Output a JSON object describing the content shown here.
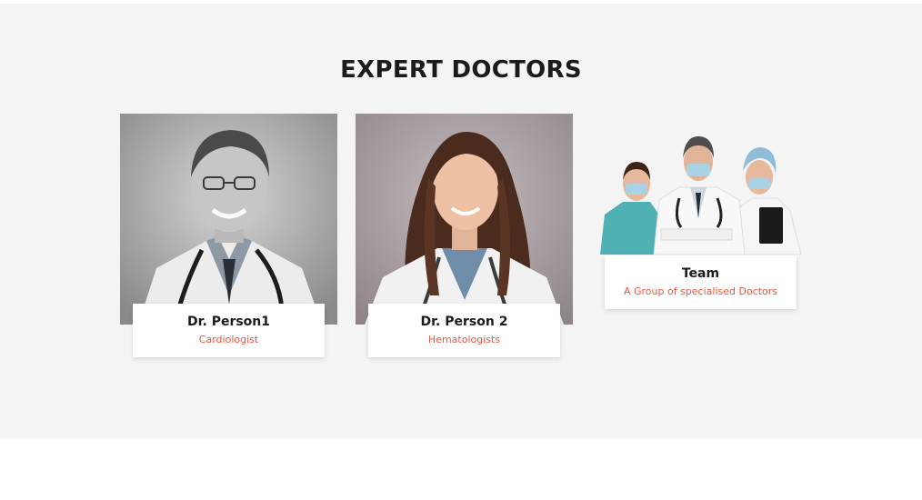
{
  "section": {
    "title": "EXPERT DOCTORS"
  },
  "doctors": [
    {
      "name": "Dr. Person1",
      "role": "Cardiologist",
      "photo": "male-doctor-portrait-bw"
    },
    {
      "name": "Dr. Person 2",
      "role": "Hematologists",
      "photo": "female-doctor-portrait"
    },
    {
      "name": "Team",
      "role": "A Group of specialised Doctors",
      "photo": "medical-team-group"
    }
  ],
  "colors": {
    "section_bg": "#f4f4f4",
    "accent": "#e8563f",
    "heading": "#1b1b1b"
  }
}
